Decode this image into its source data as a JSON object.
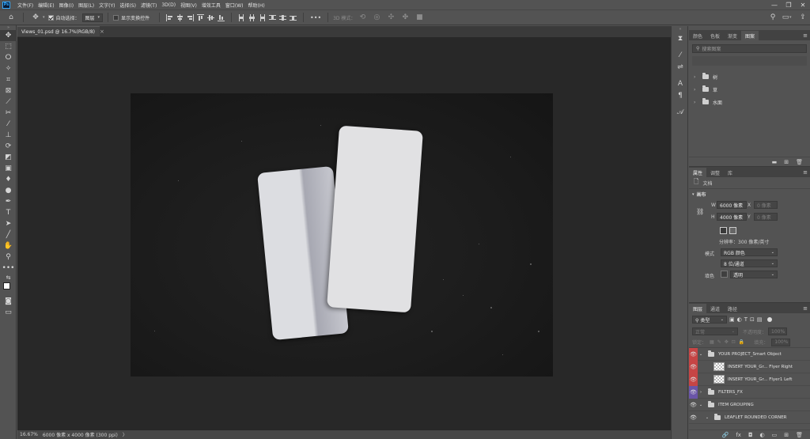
{
  "app": {
    "logo": "Ps",
    "menu": [
      "文件(F)",
      "编辑(E)",
      "图像(I)",
      "图层(L)",
      "文字(Y)",
      "选择(S)",
      "滤镜(T)",
      "3D(D)",
      "视图(V)",
      "增效工具",
      "窗口(W)",
      "帮助(H)"
    ],
    "window_controls": [
      "—",
      "❐",
      "✕"
    ]
  },
  "options_bar": {
    "auto_select_label": "自动选择：",
    "auto_select_value": "图层",
    "show_transform_label": "显示变换控件",
    "mode_3d_label": "3D 模式："
  },
  "document": {
    "tab_title": "Views_01.psd @ 16.7%(RGB/8)",
    "tab_close": "×"
  },
  "status_bar": {
    "zoom": "16.67%",
    "doc_info": "6000 像素 x 4000 像素 (300 ppi)",
    "arrow": "〉"
  },
  "libraries_panel": {
    "tabs": [
      "颜色",
      "色板",
      "渐变",
      "图案"
    ],
    "active_tab": 3,
    "search_placeholder": "搜索图案",
    "folders": [
      "树",
      "草",
      "水面"
    ]
  },
  "properties_panel": {
    "tabs": [
      "属性",
      "调整",
      "库"
    ],
    "active_tab": 0,
    "doc_label": "文档",
    "canvas_section": "画布",
    "width_label": "W",
    "width_value": "6000 像素",
    "height_label": "H",
    "height_value": "4000 像素",
    "x_label": "X",
    "y_label": "Y",
    "x_placeholder": "0 像素",
    "y_placeholder": "0 像素",
    "resolution": "分辨率：300 像素/英寸",
    "mode_label": "模式",
    "mode_value": "RGB 颜色",
    "depth_value": "8 位/通道",
    "fill_label": "填色",
    "fill_value": "透明"
  },
  "layers_panel": {
    "tabs": [
      "图层",
      "通道",
      "路径"
    ],
    "active_tab": 0,
    "filter_label": "类型",
    "blend_mode": "正常",
    "opacity_label": "不透明度：",
    "opacity_value": "100%",
    "lock_label": "锁定：",
    "fill_label": "填充：",
    "fill_value": "100%",
    "layers": [
      {
        "name": "YOUR PROJECT_Smart Object",
        "type": "group",
        "eye_color": "#c64545",
        "indent": 0
      },
      {
        "name": "INSERT YOUR_Gr... Flyer Right",
        "type": "smart",
        "eye_color": "#c64545",
        "indent": 1
      },
      {
        "name": "INSERT YOUR_Gr... Flyer1 Left",
        "type": "smart",
        "eye_color": "#c64545",
        "indent": 1
      },
      {
        "name": "FILTERS_FX",
        "type": "group",
        "eye_color": "#6a55a8",
        "indent": 0
      },
      {
        "name": "ITEM GROUPING",
        "type": "group",
        "eye_color": "",
        "indent": 0
      },
      {
        "name": "LEAFLET ROUNDED CORNER",
        "type": "group",
        "eye_color": "",
        "indent": 1
      }
    ],
    "footer_icons": [
      "🔗",
      "fx",
      "◘",
      "◐",
      "▭",
      "⊞",
      "🗑"
    ]
  },
  "colors": {
    "ui_bg": "#535353",
    "canvas_bg": "#282828",
    "accent_blue": "#31a8ff",
    "red_label": "#c64545",
    "violet_label": "#6a55a8"
  }
}
